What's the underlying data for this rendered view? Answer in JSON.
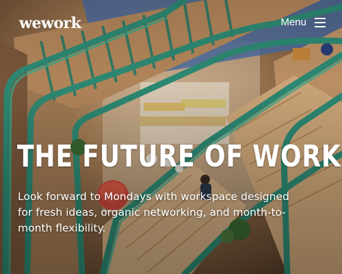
{
  "header": {
    "logo_text": "wework",
    "menu_label": "Menu",
    "menu_icon": "hamburger-icon"
  },
  "hero": {
    "headline": "THE FUTURE OF WORK",
    "tagline": "Look forward to Mondays with workspace designed for fresh ideas, organic networking, and month-to-month flexibility.",
    "image_subject": "aerial view of a green-railed spiral staircase",
    "colors": {
      "railing": "#2f8f78",
      "wood": "#c99b6a",
      "text": "#ffffff"
    }
  }
}
